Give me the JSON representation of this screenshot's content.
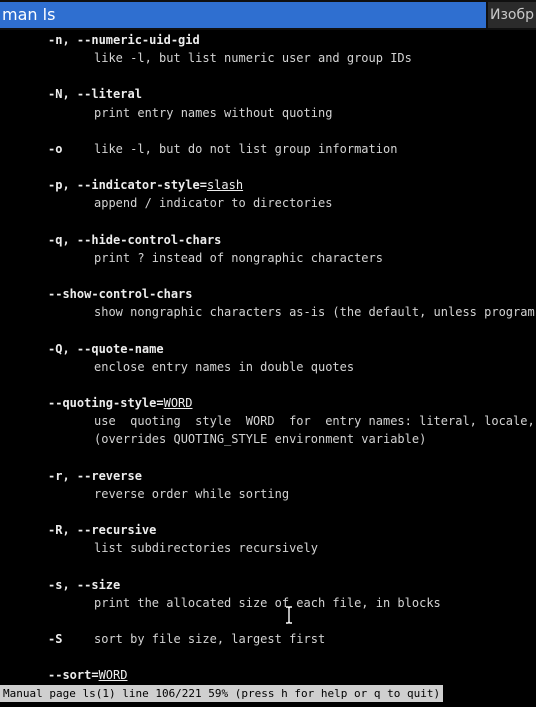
{
  "window": {
    "title": "man ls",
    "other_tab": "Изобр"
  },
  "entries": [
    {
      "opt": "-n, --numeric-uid-gid",
      "desc": [
        "like -l, but list numeric user and group IDs"
      ]
    },
    {
      "opt": "-N, --literal",
      "desc": [
        "print entry names without quoting"
      ]
    },
    {
      "short": "-o",
      "inline": "like -l, but do not list group information"
    },
    {
      "opt_parts": [
        "-p, --indicator-style=",
        "slash"
      ],
      "desc": [
        "append / indicator to directories"
      ]
    },
    {
      "opt": "-q, --hide-control-chars",
      "desc": [
        "print ? instead of nongraphic characters"
      ]
    },
    {
      "opt": "--show-control-chars",
      "desc": [
        "show nongraphic characters as-is (the default, unless program is '"
      ]
    },
    {
      "opt": "-Q, --quote-name",
      "desc": [
        "enclose entry names in double quotes"
      ]
    },
    {
      "opt_parts": [
        "--quoting-style=",
        "WORD"
      ],
      "desc": [
        "use  quoting  style  WORD  for  entry names: literal, locale, shel",
        "(overrides QUOTING_STYLE environment variable)"
      ]
    },
    {
      "opt": "-r, --reverse",
      "desc": [
        "reverse order while sorting"
      ]
    },
    {
      "opt": "-R, --recursive",
      "desc": [
        "list subdirectories recursively"
      ]
    },
    {
      "opt": "-s, --size",
      "desc": [
        "print the allocated size of each file, in blocks"
      ]
    },
    {
      "short": "-S",
      "inline": "sort by file size, largest first"
    },
    {
      "opt_parts": [
        "--sort=",
        "WORD"
      ]
    }
  ],
  "status_bar": "Manual page ls(1) line 106/221 59% (press h for help or q to quit)"
}
